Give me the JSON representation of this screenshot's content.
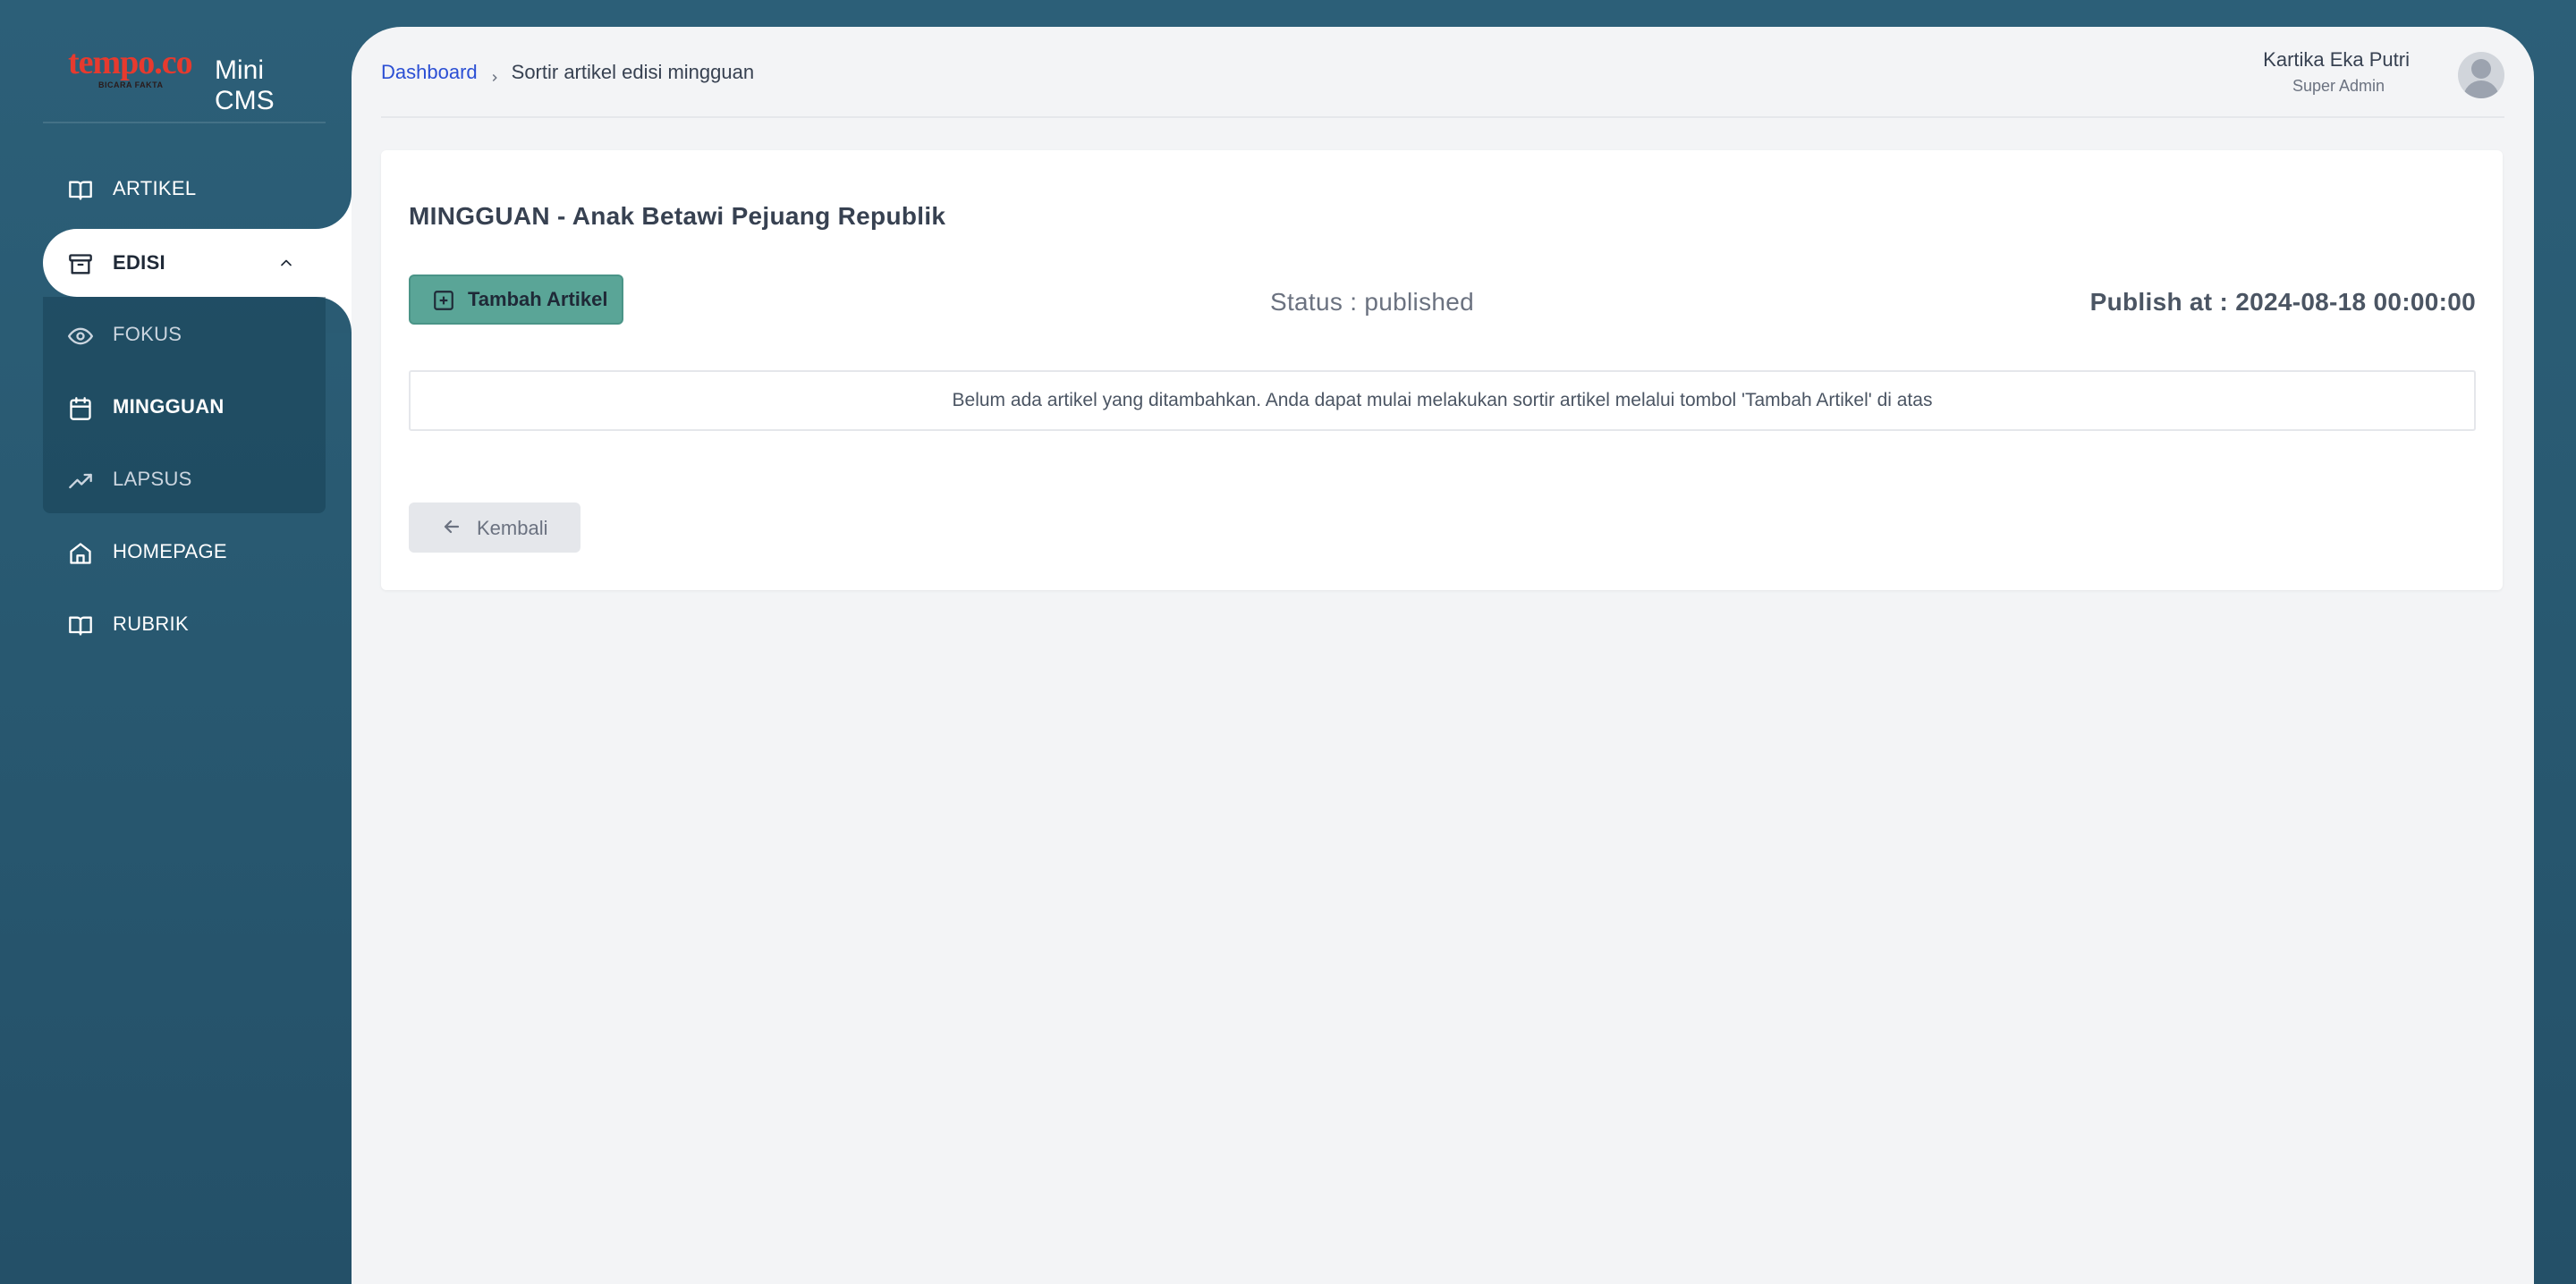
{
  "brand": {
    "logo_text": "tempo.co",
    "logo_tagline": "BICARA FAKTA",
    "app_name": "Mini CMS"
  },
  "sidebar": {
    "items": [
      {
        "label": "ARTIKEL",
        "icon": "book-open-icon"
      },
      {
        "label": "EDISI",
        "icon": "archive-box-icon",
        "expanded": true,
        "active": true
      },
      {
        "label": "FOKUS",
        "icon": "eye-icon"
      },
      {
        "label": "MINGGUAN",
        "icon": "calendar-icon",
        "active": true
      },
      {
        "label": "LAPSUS",
        "icon": "trending-up-icon"
      },
      {
        "label": "HOMEPAGE",
        "icon": "home-icon"
      },
      {
        "label": "RUBRIK",
        "icon": "book-open-icon"
      }
    ]
  },
  "breadcrumb": {
    "home": "Dashboard",
    "current": "Sortir artikel edisi mingguan"
  },
  "user": {
    "name": "Kartika Eka Putri",
    "role": "Super Admin"
  },
  "card": {
    "title": "MINGGUAN - Anak Betawi Pejuang Republik",
    "add_button": "Tambah Artikel",
    "status_text": "Status : published",
    "publish_text": "Publish at : 2024-08-18 00:00:00",
    "empty_message": "Belum ada artikel yang ditambahkan. Anda dapat mulai melakukan sortir artikel melalui tombol 'Tambah Artikel' di atas",
    "back_button": "Kembali"
  },
  "colors": {
    "sidebar_bg": "#2b5d76",
    "accent_button": "#5aa597",
    "link": "#2b4fd4",
    "logo_red": "#e63a2e"
  }
}
